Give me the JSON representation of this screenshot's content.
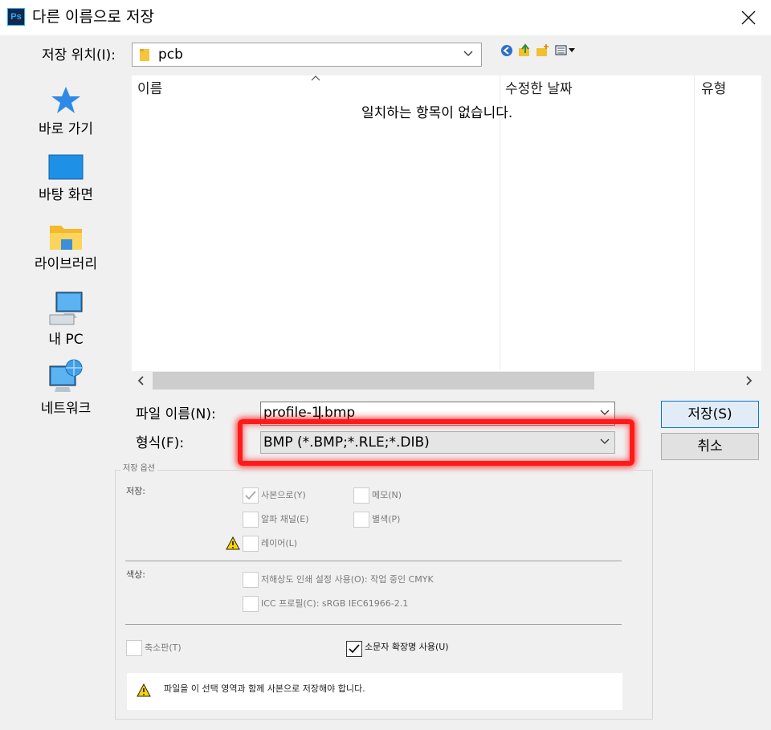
{
  "window": {
    "app_icon_text": "Ps",
    "title": "다른 이름으로 저장"
  },
  "location": {
    "label": "저장 위치(I):",
    "value": "pcb"
  },
  "places": [
    {
      "label": "바로 가기",
      "icon": "star-icon"
    },
    {
      "label": "바탕 화면",
      "icon": "desktop-icon"
    },
    {
      "label": "라이브러리",
      "icon": "library-folder-icon"
    },
    {
      "label": "내 PC",
      "icon": "computer-icon"
    },
    {
      "label": "네트워크",
      "icon": "network-icon"
    }
  ],
  "file_list": {
    "columns": [
      "이름",
      "수정한 날짜",
      "유형"
    ],
    "empty_message": "일치하는 항목이 없습니다."
  },
  "filename": {
    "label": "파일 이름(N):",
    "value": "profile-1.bmp"
  },
  "format": {
    "label": "형식(F):",
    "value": "BMP (*.BMP;*.RLE;*.DIB)"
  },
  "buttons": {
    "save": "저장(S)",
    "cancel": "취소"
  },
  "options": {
    "title": "저장 옵션",
    "save_section": "저장:",
    "as_copy": "사본으로(Y)",
    "notes": "메모(N)",
    "alpha": "알파 채널(E)",
    "spot": "별색(P)",
    "layers": "레이어(L)",
    "color_section": "색상:",
    "proof": "저해상도 인쇄 설정 사용(O): 작업 중인 CMYK",
    "icc": "ICC 프로필(C): sRGB IEC61966-2.1",
    "thumbnail": "축소판(T)",
    "lowercase_ext": "소문자 확장명 사용(U)",
    "warning": "파일을 이 선택 영역과 함께 사본으로 저장해야 합니다.",
    "as_copy_checked": true,
    "lowercase_ext_checked": true
  },
  "colors": {
    "highlight": "#ff1a1a",
    "save_button_border": "#0078d7",
    "warning_yellow": "#ffd400"
  }
}
